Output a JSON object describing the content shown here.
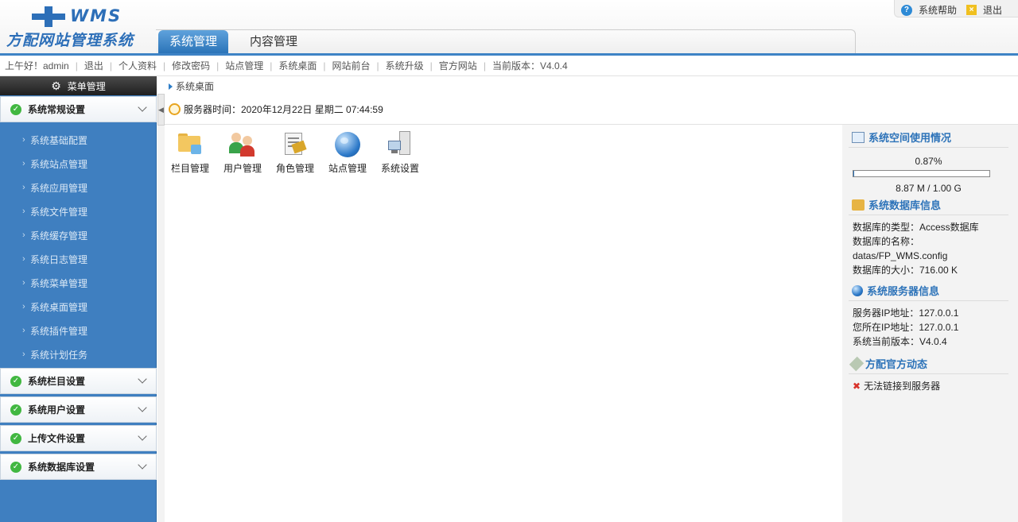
{
  "logo": {
    "brand": "WMS",
    "subtitle": "方配网站管理系统"
  },
  "top_links": {
    "help": "系统帮助",
    "logout": "退出"
  },
  "tabs": [
    {
      "label": "系统管理",
      "active": true
    },
    {
      "label": "内容管理",
      "active": false
    }
  ],
  "nav": {
    "greeting": "上午好！admin",
    "links": [
      "退出",
      "个人资料",
      "修改密码",
      "站点管理",
      "系统桌面",
      "网站前台",
      "系统升级",
      "官方网站"
    ],
    "version": "当前版本：V4.0.4"
  },
  "sidebar": {
    "title": "菜单管理",
    "groups": [
      {
        "label": "系统常规设置",
        "items": [
          "系统基础配置",
          "系统站点管理",
          "系统应用管理",
          "系统文件管理",
          "系统缓存管理",
          "系统日志管理",
          "系统菜单管理",
          "系统桌面管理",
          "系统插件管理",
          "系统计划任务"
        ]
      },
      {
        "label": "系统栏目设置"
      },
      {
        "label": "系统用户设置"
      },
      {
        "label": "上传文件设置"
      },
      {
        "label": "系统数据库设置"
      }
    ]
  },
  "breadcrumb": "系统桌面",
  "server_time": "服务器时间：2020年12月22日  星期二  07:44:59",
  "quick_links": [
    {
      "label": "栏目管理",
      "icon": "folder-icon"
    },
    {
      "label": "用户管理",
      "icon": "users-icon"
    },
    {
      "label": "角色管理",
      "icon": "role-icon"
    },
    {
      "label": "站点管理",
      "icon": "globe-icon"
    },
    {
      "label": "系统设置",
      "icon": "server-icon"
    }
  ],
  "space": {
    "title": "系统空间使用情况",
    "percent_text": "0.87%",
    "percent": 0.87,
    "amount": "8.87 M / 1.00 G"
  },
  "db": {
    "title": "系统数据库信息",
    "type": "数据库的类型：Access数据库",
    "name_label": "数据库的名称：",
    "name_value": "datas/FP_WMS.config",
    "size": "数据库的大小：716.00 K"
  },
  "server": {
    "title": "系统服务器信息",
    "ip": "服务器IP地址：127.0.0.1",
    "client_ip": "您所在IP地址：127.0.0.1",
    "version": "系统当前版本：V4.0.4"
  },
  "news": {
    "title": "方配官方动态",
    "error": "无法链接到服务器"
  },
  "colors": {
    "accent": "#2d73b9",
    "sidebar": "#3f7fc0",
    "success": "#41b741",
    "error": "#d8322a"
  }
}
